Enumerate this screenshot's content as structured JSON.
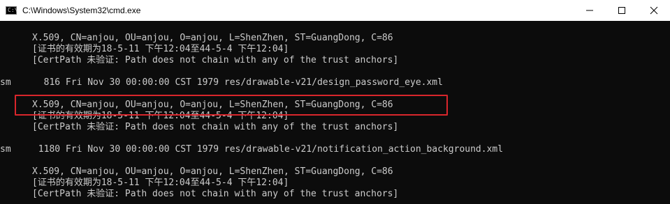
{
  "window": {
    "title": "C:\\Windows\\System32\\cmd.exe",
    "icon": "cmd-icon",
    "icon_glyph": "C:\\",
    "controls": [
      "minimize-icon",
      "maximize-icon",
      "close-icon"
    ]
  },
  "console": {
    "lines": [
      "X.509, CN=anjou, OU=anjou, O=anjou, L=ShenZhen, ST=GuangDong, C=86",
      "[证书的有效期为18-5-11 下午12:04至44-5-4 下午12:04]",
      "[CertPath 未验证: Path does not chain with any of the trust anchors]",
      "sm      816 Fri Nov 30 00:00:00 CST 1979 res/drawable-v21/design_password_eye.xml",
      "X.509, CN=anjou, OU=anjou, O=anjou, L=ShenZhen, ST=GuangDong, C=86",
      "[证书的有效期为18-5-11 下午12:04至44-5-4 下午12:04]",
      "[CertPath 未验证: Path does not chain with any of the trust anchors]",
      "sm     1180 Fri Nov 30 00:00:00 CST 1979 res/drawable-v21/notification_action_background.xml",
      "X.509, CN=anjou, OU=anjou, O=anjou, L=ShenZhen, ST=GuangDong, C=86",
      "[证书的有效期为18-5-11 下午12:04至44-5-4 下午12:04]",
      "[CertPath 未验证: Path does not chain with any of the trust anchors]"
    ]
  },
  "colors": {
    "background": "#0c0c0c",
    "text": "#cccccc",
    "highlight_border": "#d9262c",
    "titlebar": "#ffffff"
  }
}
